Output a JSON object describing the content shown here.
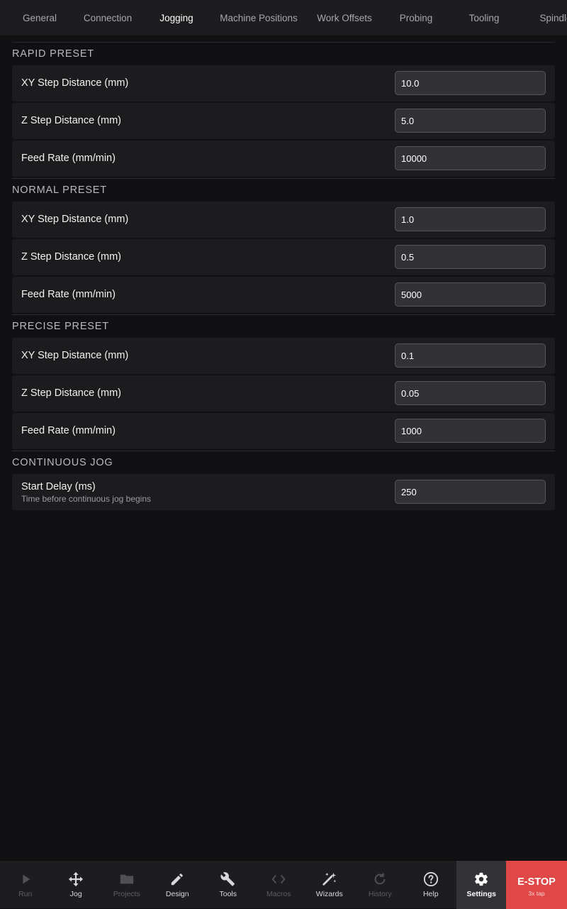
{
  "tabs": [
    {
      "label": "General"
    },
    {
      "label": "Connection"
    },
    {
      "label": "Jogging",
      "active": true
    },
    {
      "label": "Machine Positions"
    },
    {
      "label": "Work Offsets"
    },
    {
      "label": "Probing"
    },
    {
      "label": "Tooling"
    },
    {
      "label": "Spindle"
    }
  ],
  "sections": {
    "rapid": {
      "title": "RAPID PRESET",
      "xy_label": "XY Step Distance (mm)",
      "xy_value": "10.0",
      "z_label": "Z Step Distance (mm)",
      "z_value": "5.0",
      "feed_label": "Feed Rate (mm/min)",
      "feed_value": "10000"
    },
    "normal": {
      "title": "NORMAL PRESET",
      "xy_label": "XY Step Distance (mm)",
      "xy_value": "1.0",
      "z_label": "Z Step Distance (mm)",
      "z_value": "0.5",
      "feed_label": "Feed Rate (mm/min)",
      "feed_value": "5000"
    },
    "precise": {
      "title": "PRECISE PRESET",
      "xy_label": "XY Step Distance (mm)",
      "xy_value": "0.1",
      "z_label": "Z Step Distance (mm)",
      "z_value": "0.05",
      "feed_label": "Feed Rate (mm/min)",
      "feed_value": "1000"
    },
    "continuous": {
      "title": "CONTINUOUS JOG",
      "delay_label": "Start Delay (ms)",
      "delay_desc": "Time before continuous jog begins",
      "delay_value": "250"
    }
  },
  "nav": {
    "run": {
      "label": "Run",
      "icon": "play-icon",
      "disabled": true
    },
    "jog": {
      "label": "Jog",
      "icon": "move-arrows-icon"
    },
    "projects": {
      "label": "Projects",
      "icon": "folder-icon",
      "disabled": true
    },
    "design": {
      "label": "Design",
      "icon": "pencil-icon"
    },
    "tools": {
      "label": "Tools",
      "icon": "wrench-icon"
    },
    "macros": {
      "label": "Macros",
      "icon": "code-brackets-icon",
      "disabled": true
    },
    "wizards": {
      "label": "Wizards",
      "icon": "magic-wand-icon"
    },
    "history": {
      "label": "History",
      "icon": "refresh-icon",
      "disabled": true
    },
    "help": {
      "label": "Help",
      "icon": "question-circle-icon"
    },
    "settings": {
      "label": "Settings",
      "icon": "gear-icon",
      "active": true
    }
  },
  "estop": {
    "label": "E-STOP",
    "hint": "3x tap",
    "color": "#e04848"
  },
  "colors": {
    "background": "#111113",
    "panel": "#1c1c1f",
    "bar": "#1d1d20",
    "field": "#323236"
  }
}
